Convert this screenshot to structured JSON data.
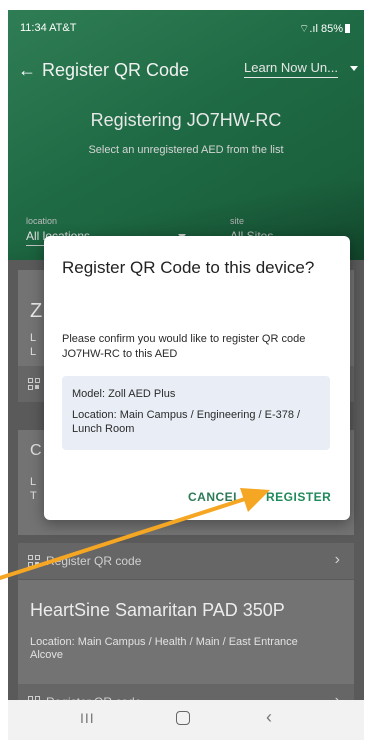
{
  "status_bar": {
    "time": "11:34 AT&T",
    "signal": "⌔.ıl 85%"
  },
  "header": {
    "back_icon": "←",
    "title": "Register QR Code",
    "learn_now": "Learn Now Un...",
    "registering": "Registering JO7HW-RC",
    "instruction": "Select an unregistered AED from the list"
  },
  "filters": {
    "location_label": "location",
    "location_value": "All locations",
    "site_label": "site",
    "site_value": "All Sites"
  },
  "list": {
    "card_a_title": "Z",
    "card_a_line1": "L",
    "card_a_line2": "L",
    "card_b_line0": "C",
    "card_b_line1": "L",
    "card_b_line2": "T",
    "register_qr_label": "Register QR code",
    "chevron": "›",
    "card_c_title": "HeartSine Samaritan PAD 350P",
    "card_c_location": "Location: Main Campus / Health / Main / East Entrance Alcove",
    "card_c_footer": "Register QR code"
  },
  "dialog": {
    "title": "Register QR Code to this device?",
    "body": "Please confirm you would like to register QR code JO7HW-RC to this AED",
    "model": "Model: Zoll AED Plus",
    "location": "Location: Main Campus / Engineering / E-378 / Lunch Room",
    "cancel_label": "CANCEL",
    "register_label": "REGISTER"
  },
  "navbar": {
    "recents": "III",
    "back": "‹"
  },
  "colors": {
    "header_green": "#1f6b45",
    "accent_green": "#1f8a5a",
    "arrow": "#f5a623",
    "info_box": "#e9eef6"
  },
  "icons": {
    "back": "back-arrow-icon",
    "learn_dropdown": "caret-down-icon",
    "qr": "qr-code-icon",
    "chevron": "chevron-right-icon",
    "nav_home": "home-icon"
  }
}
